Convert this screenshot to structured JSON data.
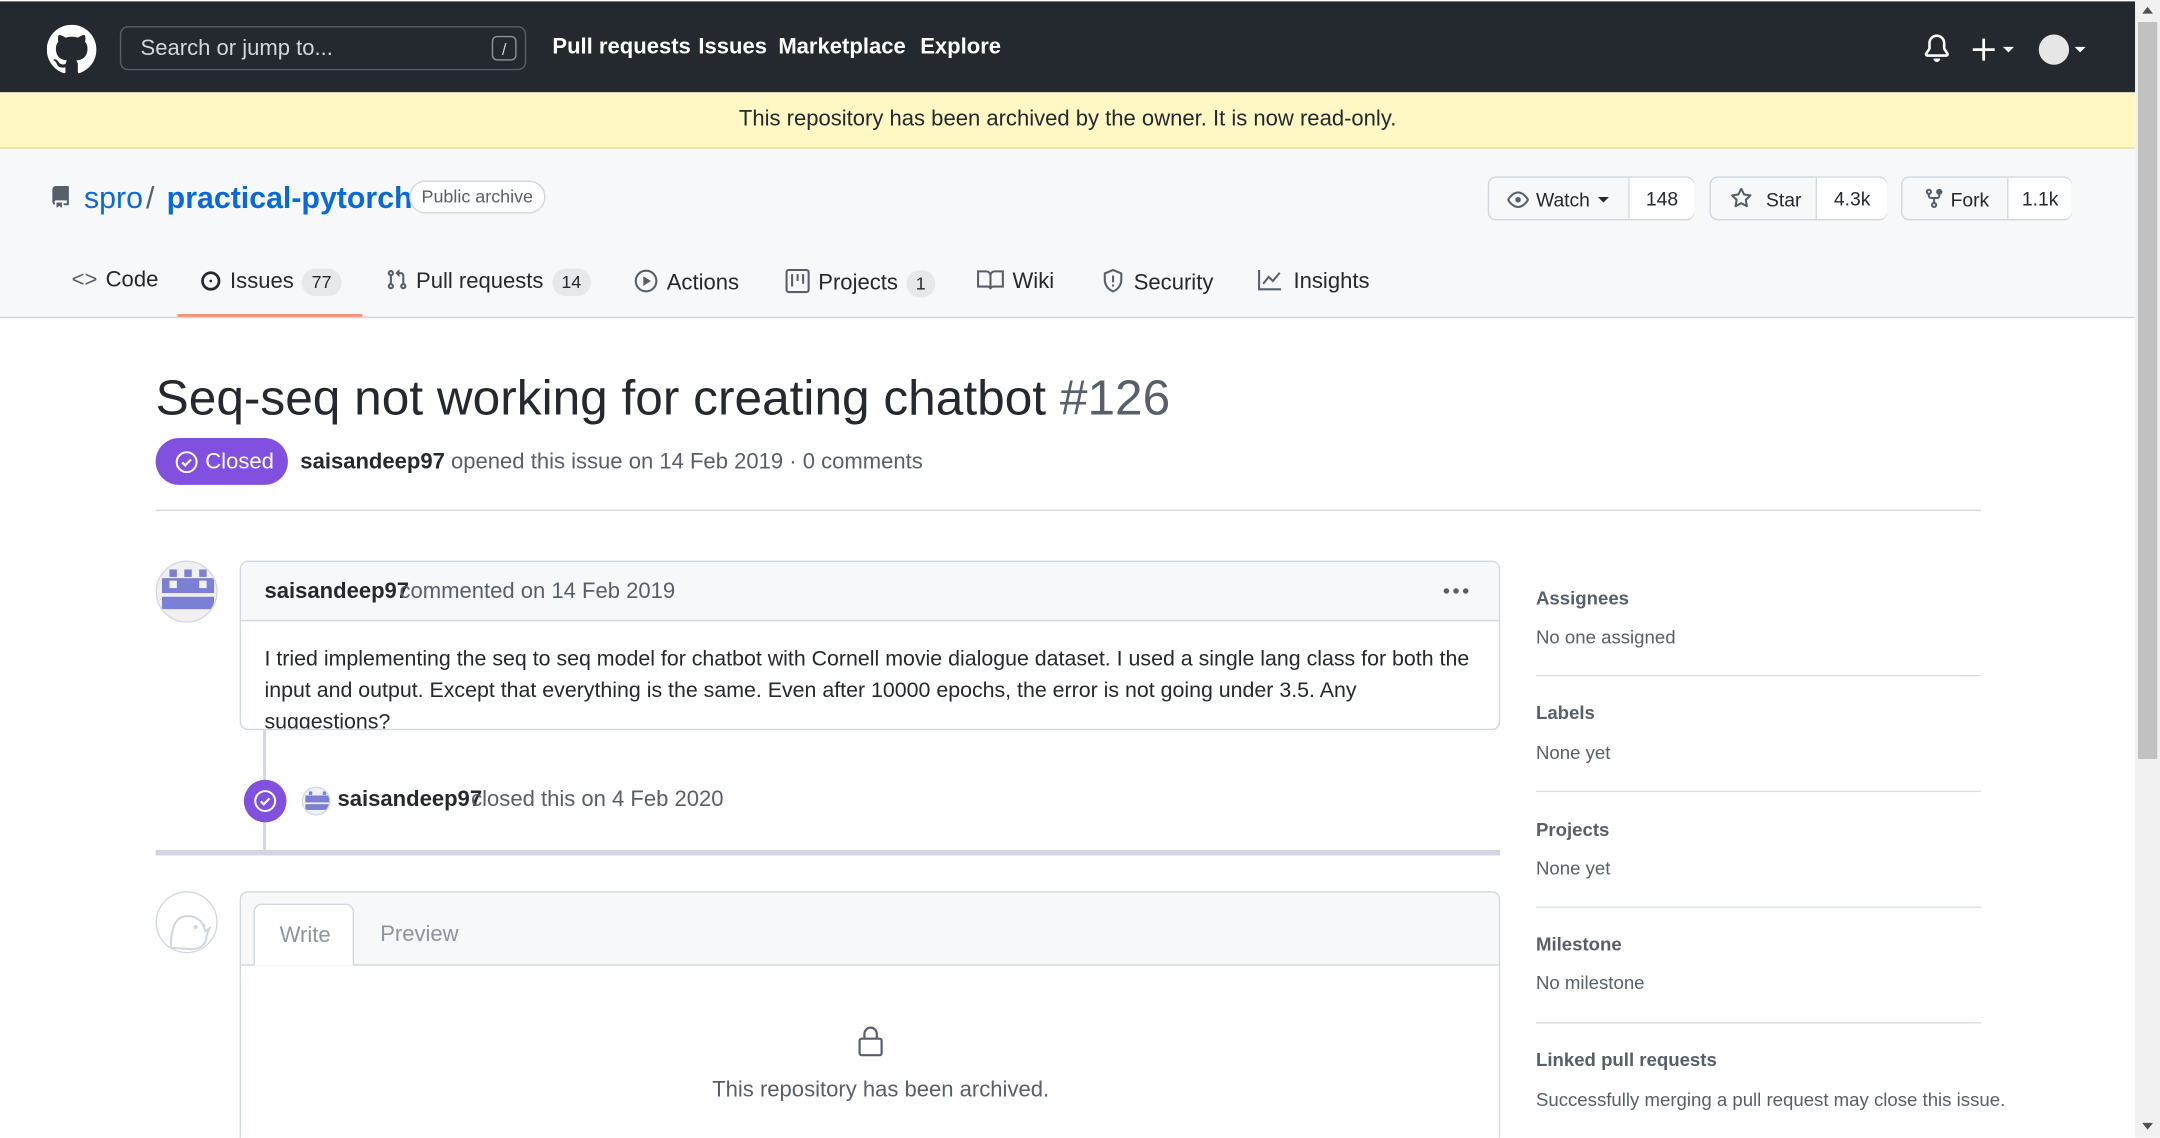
{
  "header": {
    "search_placeholder": "Search or jump to...",
    "search_key": "/",
    "nav": [
      "Pull requests",
      "Issues",
      "Marketplace",
      "Explore"
    ]
  },
  "banner": "This repository has been archived by the owner. It is now read-only.",
  "repo": {
    "owner": "spro",
    "separator": "/",
    "name": "practical-pytorch",
    "visibility": "Public archive",
    "watch_label": "Watch",
    "watch_count": "148",
    "star_label": "Star",
    "star_count": "4.3k",
    "fork_label": "Fork",
    "fork_count": "1.1k"
  },
  "tabs": [
    {
      "label": "Code",
      "count": ""
    },
    {
      "label": "Issues",
      "count": "77"
    },
    {
      "label": "Pull requests",
      "count": "14"
    },
    {
      "label": "Actions",
      "count": ""
    },
    {
      "label": "Projects",
      "count": "1"
    },
    {
      "label": "Wiki",
      "count": ""
    },
    {
      "label": "Security",
      "count": ""
    },
    {
      "label": "Insights",
      "count": ""
    }
  ],
  "issue": {
    "title": "Seq-seq not working for creating chatbot",
    "number": "#126",
    "state": "Closed",
    "author": "saisandeep97",
    "meta_text": "opened this issue on 14 Feb 2019 · 0 comments"
  },
  "comment": {
    "author": "saisandeep97",
    "meta": "commented on 14 Feb 2019",
    "body": "I tried implementing the seq to seq model for chatbot with Cornell movie dialogue dataset. I used a single lang class for both the input and output. Except that everything is the same. Even after 10000 epochs, the error is not going under 3.5. Any suggestions?"
  },
  "event": {
    "author": "saisandeep97",
    "text": "closed this on 4 Feb 2020"
  },
  "editor": {
    "write_tab": "Write",
    "preview_tab": "Preview",
    "archived_msg": "This repository has been archived."
  },
  "sidebar": [
    {
      "heading": "Assignees",
      "value": "No one assigned"
    },
    {
      "heading": "Labels",
      "value": "None yet"
    },
    {
      "heading": "Projects",
      "value": "None yet"
    },
    {
      "heading": "Milestone",
      "value": "No milestone"
    },
    {
      "heading": "Linked pull requests",
      "value": "Successfully merging a pull request may close this issue."
    }
  ],
  "colors": {
    "header_bg": "#24292f",
    "banner_bg": "#fff8c5",
    "closed_purple": "#8250df",
    "link_blue": "#0969da",
    "tab_underline": "#fd8c73"
  }
}
